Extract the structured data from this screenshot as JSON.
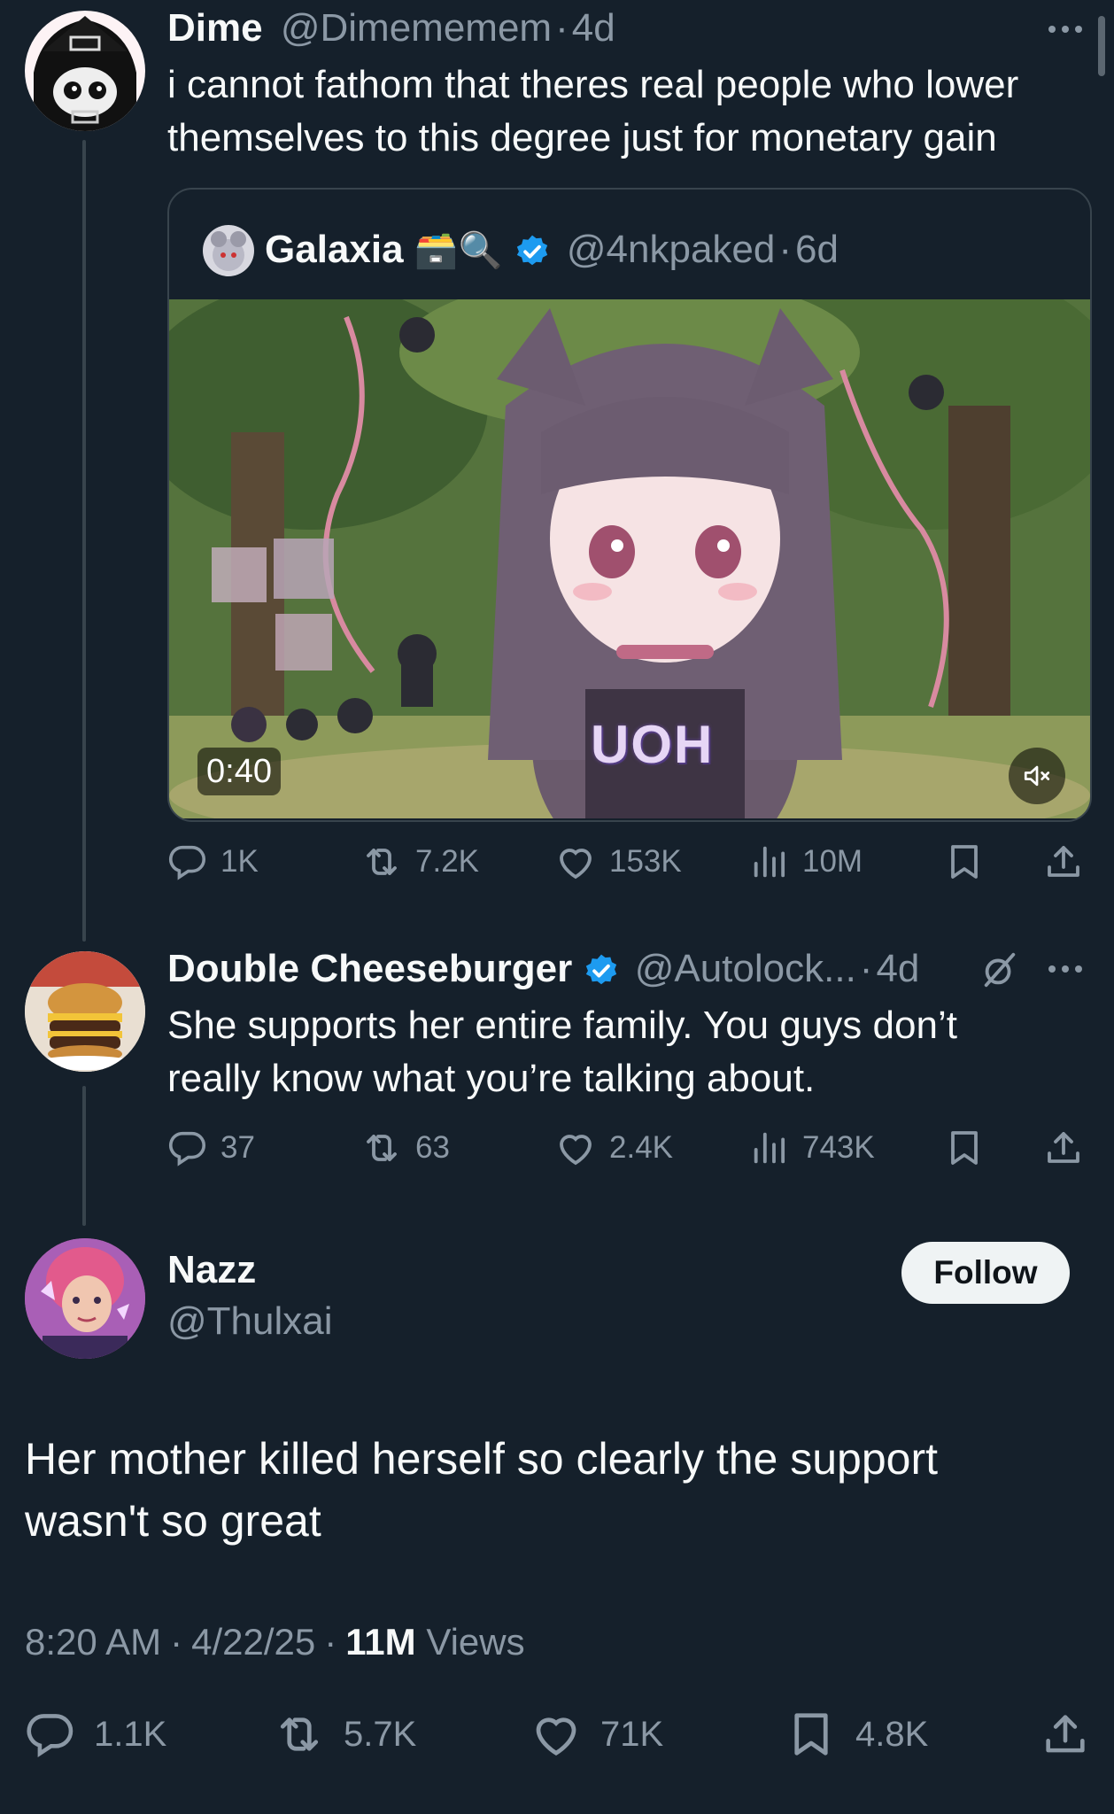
{
  "colors": {
    "background": "#15202b",
    "text": "#f7f9f9",
    "muted": "#8b98a5",
    "accent": "#1d9bf0",
    "border": "#38444d"
  },
  "tweets": [
    {
      "display_name": "Dime",
      "handle": "@Dimememem",
      "separator": "·",
      "age": "4d",
      "text": "i cannot fathom that theres real people who lower themselves to this degree just for monetary gain",
      "quote": {
        "display_name": "Galaxia",
        "name_emoji": "🗃️🔍",
        "verified": true,
        "handle": "@4nkpaked",
        "separator": "·",
        "age": "6d",
        "video": {
          "duration": "0:40",
          "caption": "UOH",
          "muted_icon": "speaker-muted-icon"
        }
      },
      "stats": {
        "replies": "1K",
        "reposts": "7.2K",
        "likes": "153K",
        "views": "10M"
      }
    },
    {
      "display_name": "Double Cheeseburger",
      "verified": true,
      "handle": "@Autolock...",
      "separator": "·",
      "age": "4d",
      "text": "She supports her entire family. You guys don’t really know what you’re talking about.",
      "stats": {
        "replies": "37",
        "reposts": "63",
        "likes": "2.4K",
        "views": "743K"
      }
    }
  ],
  "main_tweet": {
    "display_name": "Nazz",
    "handle": "@Thulxai",
    "follow_label": "Follow",
    "text": "Her mother killed herself so clearly the support wasn't so great",
    "time": "8:20 AM",
    "separator": "·",
    "date": "4/22/25",
    "views_count": "11M",
    "views_label": "Views",
    "stats": {
      "replies": "1.1K",
      "reposts": "5.7K",
      "likes": "71K",
      "bookmarks": "4.8K"
    }
  }
}
